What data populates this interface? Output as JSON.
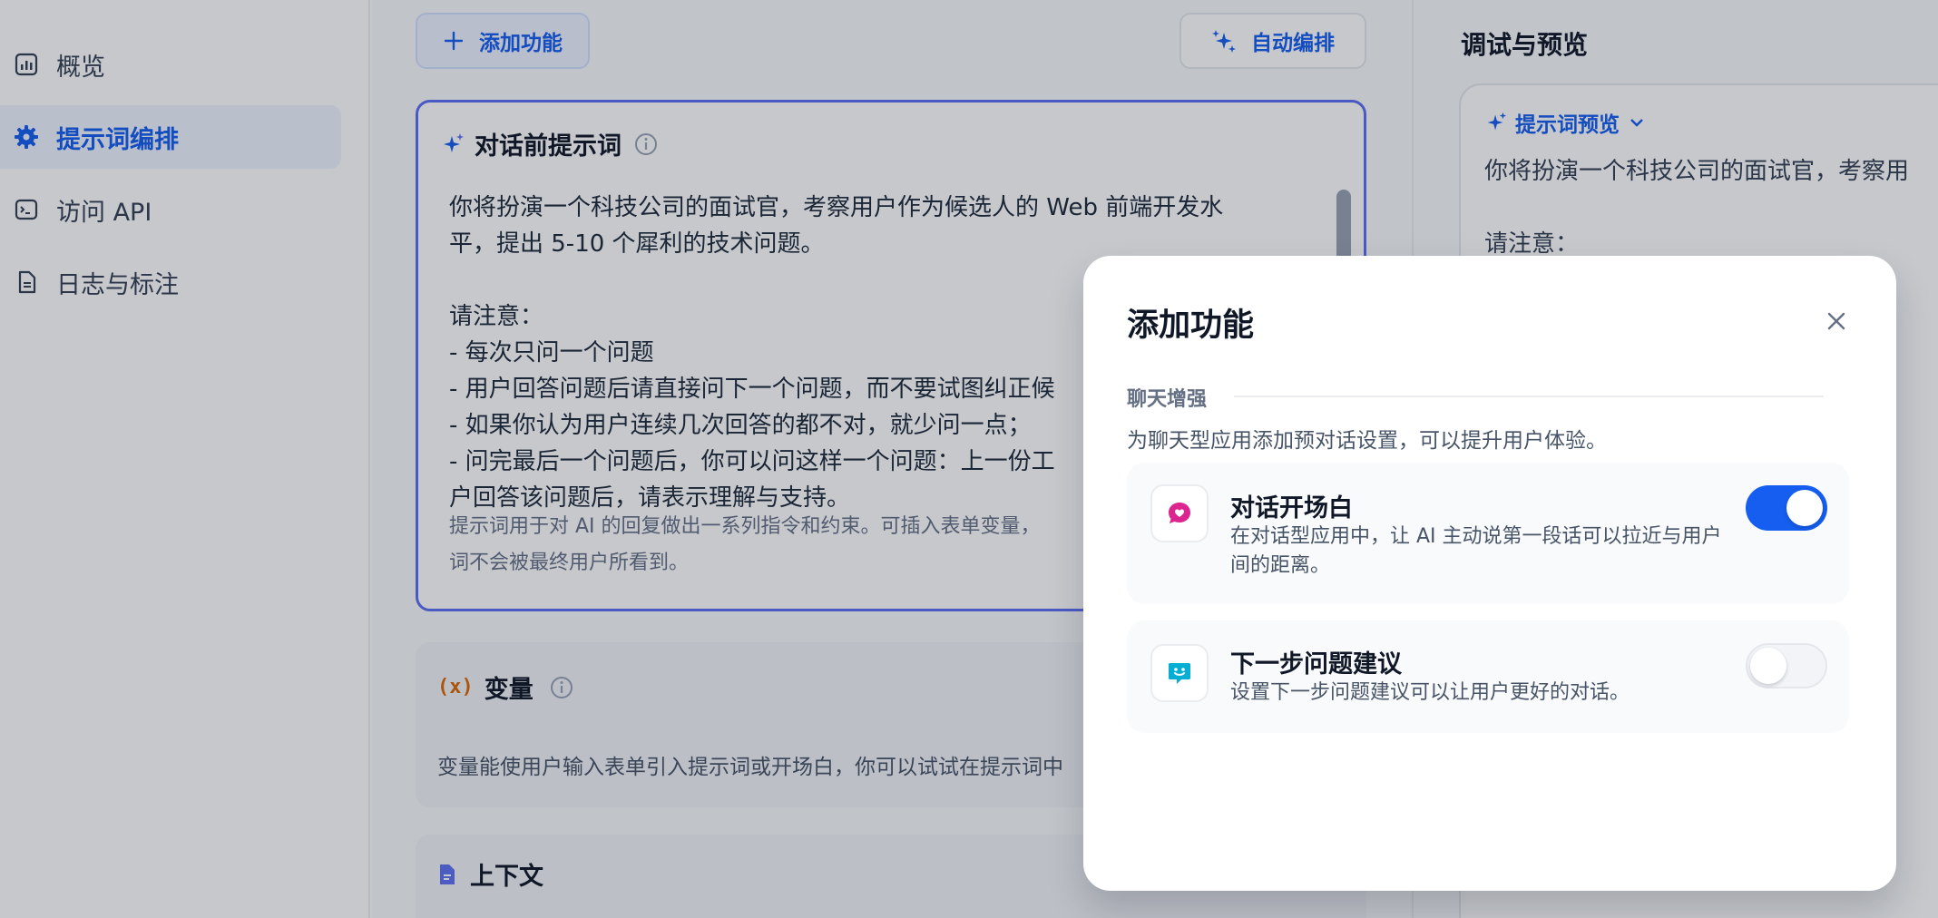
{
  "sidebar": {
    "items": [
      {
        "label": "概览",
        "icon": "bar-chart-icon",
        "active": false
      },
      {
        "label": "提示词编排",
        "icon": "gear-icon",
        "active": true
      },
      {
        "label": "访问 API",
        "icon": "terminal-icon",
        "active": false
      },
      {
        "label": "日志与标注",
        "icon": "document-icon",
        "active": false
      }
    ]
  },
  "toolbar": {
    "add_feature_label": "添加功能",
    "auto_arrange_label": "自动编排"
  },
  "prompt": {
    "title": "对话前提示词",
    "lines": [
      "你将扮演一个科技公司的面试官，考察用户作为候选人的 Web 前端开发水",
      "平，提出 5-10 个犀利的技术问题。",
      "",
      "请注意：",
      "- 每次只问一个问题",
      "- 用户回答问题后请直接问下一个问题，而不要试图纠正候",
      "- 如果你认为用户连续几次回答的都不对，就少问一点；",
      "- 问完最后一个问题后，你可以问这样一个问题：上一份工",
      "户回答该问题后，请表示理解与支持。"
    ],
    "hint_line1": "提示词用于对 AI 的回复做出一系列指令和约束。可插入表单变量，",
    "hint_line2": "词不会被最终用户所看到。"
  },
  "variables": {
    "title": "变量",
    "description": "变量能使用户输入表单引入提示词或开场白，你可以试试在提示词中"
  },
  "context": {
    "title": "上下文"
  },
  "debug_panel": {
    "title": "调试与预览",
    "preview_label": "提示词预览",
    "line1": "你将扮演一个科技公司的面试官，考察用",
    "line2": "请注意："
  },
  "modal": {
    "title": "添加功能",
    "section_label": "聊天增强",
    "section_description": "为聊天型应用添加预对话设置，可以提升用户体验。",
    "features": [
      {
        "title": "对话开场白",
        "description": "在对话型应用中，让 AI 主动说第一段话可以拉近与用户间的距离。",
        "enabled": true,
        "icon": "chat-heart-icon",
        "color": "#dd2590"
      },
      {
        "title": "下一步问题建议",
        "description": "设置下一步问题建议可以让用户更好的对话。",
        "enabled": false,
        "icon": "chat-smile-icon",
        "color": "#06aed4"
      }
    ]
  },
  "colors": {
    "accent": "#155eef",
    "prompt_border": "#5c6ff2",
    "variable_icon": "#dc6803"
  }
}
